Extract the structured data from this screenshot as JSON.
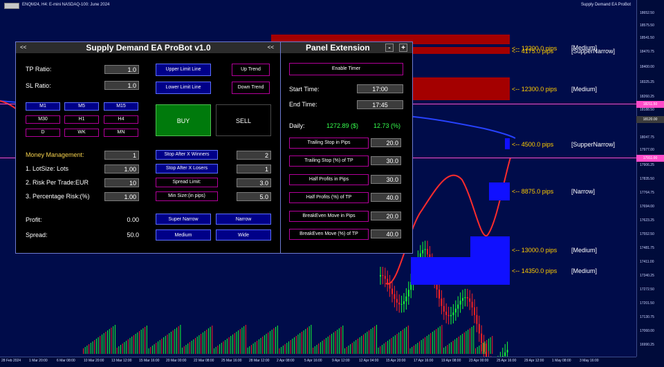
{
  "chart": {
    "symbol": "ENQM24, H4:  E-mini NASDAQ-100: June 2024",
    "ea_name": "Supply Demand EA ProBot",
    "colors": {
      "background": "#000c4a",
      "candle_up": "#18ff36",
      "candle_down": "#ff2222",
      "zone_supply": "#a40000",
      "zone_demand": "#1010ff",
      "line": "#ff3344"
    }
  },
  "price_axis": {
    "ticks": [
      "18652.50",
      "18575.50",
      "18541.50",
      "18470.75",
      "18400.00",
      "18325.25",
      "18260.25",
      "18188.50",
      "18047.75",
      "17977.00",
      "17906.25",
      "17835.50",
      "17764.75",
      "17694.00",
      "17623.25",
      "17552.50",
      "17481.75",
      "17411.00",
      "17340.25",
      "17272.50",
      "17201.50",
      "17130.75",
      "17060.00",
      "16990.25",
      "16919.50"
    ],
    "highlight_1": "18211.50",
    "highlight_2": "18120.00",
    "highlight_3": "17911.00"
  },
  "time_axis": {
    "labels": [
      "28 Feb 2024",
      "1 Mar 20:00",
      "6 Mar 08:00",
      "10 Mar 20:00",
      "13 Mar 12:00",
      "15 Mar 16:00",
      "20 Mar 00:00",
      "22 Mar 08:00",
      "25 Mar 16:00",
      "28 Mar 12:00",
      "2 Apr 08:00",
      "5 Apr 16:00",
      "9 Apr 12:00",
      "12 Apr 04:00",
      "15 Apr 20:00",
      "17 Apr 16:00",
      "19 Apr 08:00",
      "23 Apr 00:00",
      "25 Apr 16:00",
      "29 Apr 12:00",
      "1 May 08:00",
      "3 May 16:00"
    ]
  },
  "zones": [
    {
      "label": "<-- 13200.0 pips",
      "overlay": "<-- 4175.0 pips",
      "type": "[Medium]",
      "type2": "[SupperNarrow]"
    },
    {
      "label": "<-- 12300.0 pips",
      "type": "[Medium]"
    },
    {
      "label": "<-- 4500.0 pips",
      "type": "[SupperNarrow]"
    },
    {
      "label": "<-- 8875.0 pips",
      "type": "[Narrow]"
    },
    {
      "label": "<-- 13000.0 pips",
      "type": "[Medium]"
    },
    {
      "label": "<-- 14350.0 pips",
      "type": "[Medium]"
    }
  ],
  "panel": {
    "title": "Supply Demand EA ProBot v1.0",
    "left_arrows": "<<",
    "right_arrows": "<<",
    "tp_label": "TP Ratio:",
    "tp_value": "1.0",
    "sl_label": "SL Ratio:",
    "sl_value": "1.0",
    "upper_limit": "Upper Limit Line",
    "lower_limit": "Lower Limit Line",
    "up_trend": "Up Trend",
    "down_trend": "Down Trend",
    "timeframes": [
      "M1",
      "M5",
      "M15",
      "M30",
      "H1",
      "H4",
      "D",
      "WK",
      "MN"
    ],
    "buy": "BUY",
    "sell": "SELL",
    "money_management": "Money Management:",
    "money_value": "1",
    "lot_size_label": "1. LotSize: Lots",
    "lot_size_value": "1.00",
    "risk_trade_label": "2. Risk Per Trade:EUR",
    "risk_trade_value": "10",
    "percentage_label": "3. Percentage Risk:(%)",
    "percentage_value": "1.00",
    "stop_winners": "Stop After X Winners",
    "stop_winners_value": "2",
    "stop_losers": "Stop After X Losers",
    "stop_losers_value": "1",
    "spread_limit": "Spread Limit:",
    "spread_limit_value": "3.0",
    "min_size": "Min Size:(in pips)",
    "min_size_value": "5.0",
    "profit_label": "Profit:",
    "profit_value": "0.00",
    "spread_label": "Spread:",
    "spread_value": "50.0",
    "super_narrow": "Super Narrow",
    "narrow": "Narrow",
    "medium": "Medium",
    "wide": "Wide"
  },
  "extension": {
    "title": "Panel Extension",
    "minus": "-",
    "plus": "+",
    "enable_timer": "Enable Timer",
    "start_time_label": "Start Time:",
    "start_time_value": "17:00",
    "end_time_label": "End Time:",
    "end_time_value": "17:45",
    "daily_label": "Daily:",
    "daily_value": "1272.89 ($)",
    "daily_percent": "12.73 (%)",
    "settings": [
      {
        "label": "Trailing Stop in Pips",
        "value": "20.0"
      },
      {
        "label": "Trailing Stop (%) of TP",
        "value": "30.0"
      },
      {
        "label": "Half Profits in Pips",
        "value": "30.0"
      },
      {
        "label": "Half Profits (%) of TP",
        "value": "40.0"
      },
      {
        "label": "BreakEven Move in Pips",
        "value": "20.0"
      },
      {
        "label": "BreakEven Move (%) of TP",
        "value": "40.0"
      }
    ]
  }
}
